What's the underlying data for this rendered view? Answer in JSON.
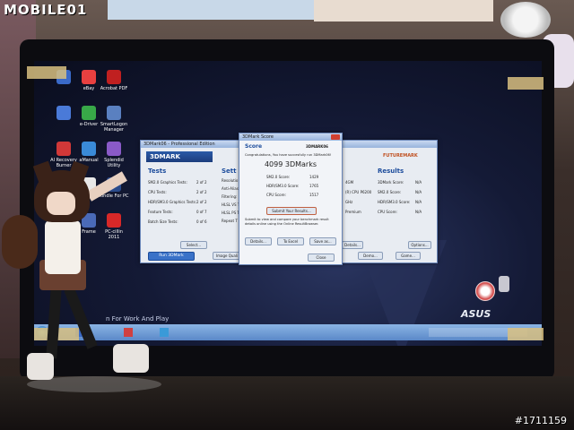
{
  "watermark": {
    "site": "MOBILE01",
    "post_id": "#1711159"
  },
  "desktop_icons": [
    {
      "label": "",
      "color": "#3a6ac8"
    },
    {
      "label": "eBay",
      "color": "#e84040"
    },
    {
      "label": "Acrobat PDF",
      "color": "#c02020"
    },
    {
      "label": "",
      "color": "#4a7ad8"
    },
    {
      "label": "e-Driver",
      "color": "#38a848"
    },
    {
      "label": "SmartLogon Manager",
      "color": "#5a80c0"
    },
    {
      "label": "AI Recovery Burner",
      "color": "#d03838"
    },
    {
      "label": "aManual",
      "color": "#3a8ad8"
    },
    {
      "label": "Splendid Utility",
      "color": "#8a5ac8"
    },
    {
      "label": "Game Center",
      "color": "#4a9ae8"
    },
    {
      "label": "",
      "color": "#e8e8e8"
    },
    {
      "label": "Kindle For PC",
      "color": "#2a4a8a"
    },
    {
      "label": "Times Reader",
      "color": "#f0f0f0"
    },
    {
      "label": "Frame",
      "color": "#4a6ab8"
    },
    {
      "label": "PC-cillin 2011",
      "color": "#d82828"
    }
  ],
  "main_window": {
    "title": "3DMark06 - Professional Edition",
    "logo": "3DMARK",
    "tests_header": "Tests",
    "settings_header": "Sett",
    "results_header": "Results",
    "futuremark_logo": "FUTUREMARK",
    "tests": [
      {
        "name": "SM2.0 Graphics Tests:",
        "value": "2 of 2"
      },
      {
        "name": "CPU Tests:",
        "value": "2 of 2"
      },
      {
        "name": "HDR/SM3.0 Graphics Tests:",
        "value": "2 of 2"
      },
      {
        "name": "Feature Tests:",
        "value": "0 of 7"
      },
      {
        "name": "Batch Size Tests:",
        "value": "0 of 6"
      }
    ],
    "settings_rows": [
      "Resolutio",
      "Anti-Alias",
      "Filtering:",
      "HLSL VS T",
      "HLSL PS T",
      "Repeat T"
    ],
    "system_rows": [
      "4GM",
      "(R) CPU P6200",
      "GHz",
      "Premium"
    ],
    "results": [
      {
        "name": "3DMark Score:",
        "value": "N/A"
      },
      {
        "name": "SM2.0 Score:",
        "value": "N/A"
      },
      {
        "name": "HDR/SM3.0 Score:",
        "value": "N/A"
      },
      {
        "name": "CPU Score:",
        "value": "N/A"
      }
    ],
    "select_button": "Select...",
    "run_button": "Run 3DMark",
    "image_quality_button": "Image Quali",
    "details_button_left": "Details...",
    "demo_button": "Demo...",
    "options_button": "Options...",
    "game_button": "Game..."
  },
  "score_window": {
    "title": "3DMark Score",
    "header": "Score",
    "logo": "3DMARK06",
    "congrats": "Congratulations, You have succesfully run 3DMark06!",
    "total": "4099 3DMarks",
    "rows": [
      {
        "name": "SM2.0 Score:",
        "value": "1429"
      },
      {
        "name": "HDR/SM3.0 Score:",
        "value": "1765"
      },
      {
        "name": "CPU Score:",
        "value": "1517"
      }
    ],
    "submit_button": "Submit Your Results...",
    "submit_text": "Submit to view and compare your benchmark result details online using the Online ResultBrowser.",
    "details_button": "Details...",
    "excel_button": "To Excel",
    "save_button": "Save as...",
    "close_button": "Close"
  },
  "wallpaper": {
    "tagline": "n For Work And Play",
    "brand": "ASUS"
  },
  "colors": {
    "accent": "#3a72c8",
    "header": "#1c4c9c"
  }
}
